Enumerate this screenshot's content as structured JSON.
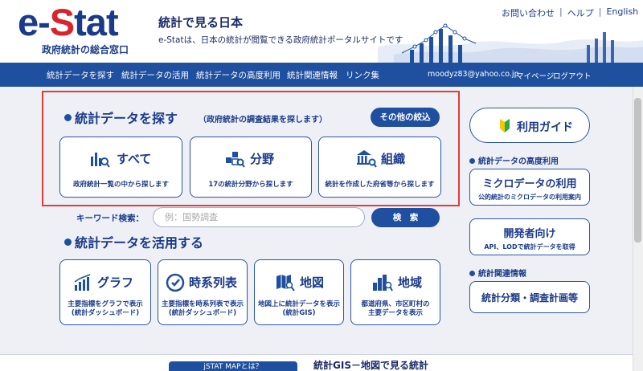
{
  "header": {
    "logo_prefix": "e-",
    "logo_s": "S",
    "logo_suffix": "tat",
    "logo_subtitle": "政府統計の総合窓口",
    "site_title": "統計で見る日本",
    "site_description": "e-Statは、日本の統計が閲覧できる政府統計ポータルサイトです",
    "top_links": [
      "お問い合わせ",
      "ヘルプ",
      "English"
    ],
    "top_link_separator": "|"
  },
  "nav": {
    "items": [
      "統計データを探す",
      "統計データの活用",
      "統計データの高度利用",
      "統計関連情報",
      "リンク集"
    ],
    "user_email": "moodyz83@yahoo.co.jp",
    "mypage": "マイページ",
    "logout": "ログアウト"
  },
  "search_section": {
    "title": "統計データを探す",
    "note": "（政府統計の調査結果を探します）",
    "other_filter_button": "その他の絞込",
    "cards": [
      {
        "title": "すべて",
        "desc": "政府統計一覧の中から探します",
        "icon": "bar-chart-search-icon"
      },
      {
        "title": "分野",
        "desc": "17の統計分野から探します",
        "icon": "cubes-search-icon"
      },
      {
        "title": "組織",
        "desc": "統計を作成した府省等から探します",
        "icon": "building-search-icon"
      }
    ],
    "keyword_label": "キーワード検索：",
    "keyword_placeholder": "例：国勢調査",
    "search_button": "検　索"
  },
  "use_section": {
    "title": "統計データを活用する",
    "cards": [
      {
        "title": "グラフ",
        "desc_line1": "主要指標をグラフで表示",
        "desc_line2": "(統計ダッシュボード)",
        "icon": "graph-icon"
      },
      {
        "title": "時系列表",
        "desc_line1": "主要指標を時系列表で表示",
        "desc_line2": "(統計ダッシュボード)",
        "icon": "clock-icon"
      },
      {
        "title": "地図",
        "desc_line1": "地図上に統計データを表示",
        "desc_line2": "(統計GIS)",
        "icon": "map-icon"
      },
      {
        "title": "地域",
        "desc_line1": "都道府県、市区町村の",
        "desc_line2": "主要データを表示",
        "icon": "city-icon"
      }
    ]
  },
  "right_column": {
    "guide_button": "利用ガイド",
    "advanced_heading": "統計データの高度利用",
    "microdata_title": "ミクロデータの利用",
    "microdata_desc": "公的統計のミクロデータの利用案内",
    "developer_title": "開発者向け",
    "developer_desc": "API、LODで統計データを取得",
    "related_heading": "統計関連情報",
    "classification_button": "統計分類・調査計画等"
  },
  "bottom": {
    "istat_button": "jSTAT MAPとは？",
    "gis_title": "統計GIS－地図で見る統計"
  },
  "colors": {
    "brand_blue": "#1f4f9f",
    "logo_red": "#d9242e",
    "highlight_red": "#e23b3b",
    "background": "#eef0f5"
  }
}
